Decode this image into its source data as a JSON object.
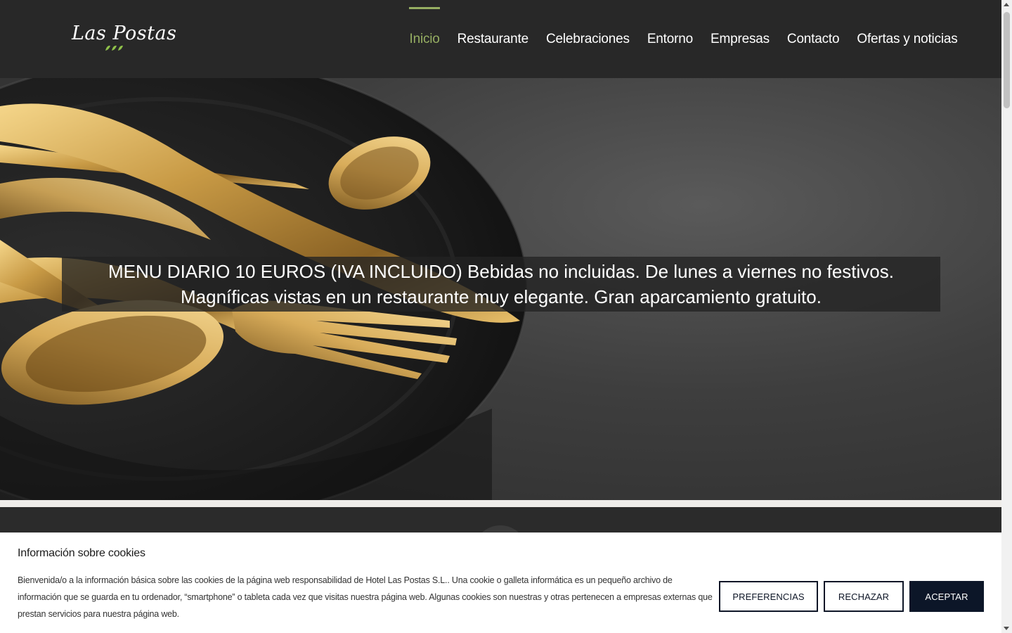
{
  "header": {
    "logo_text": "Las Postas",
    "nav": [
      {
        "label": "Inicio",
        "active": true
      },
      {
        "label": "Restaurante",
        "active": false
      },
      {
        "label": "Celebraciones",
        "active": false
      },
      {
        "label": "Entorno",
        "active": false
      },
      {
        "label": "Empresas",
        "active": false
      },
      {
        "label": "Contacto",
        "active": false
      },
      {
        "label": "Ofertas y noticias",
        "active": false
      }
    ],
    "accent_color": "#96ae62"
  },
  "hero": {
    "caption": "MENU DIARIO 10 EUROS (IVA INCLUIDO) Bebidas no incluidas. De lunes a viernes no festivos. Magníficas vistas en un restaurante muy elegante. Gran aparcamiento gratuito.",
    "image_subject": "gold cutlery on black plate"
  },
  "cookie_banner": {
    "title": "Información sobre cookies",
    "text": "Bienvenida/o a la información básica sobre las cookies de la página web responsabilidad de Hotel Las Postas S.L.. Una cookie o galleta informática es un pequeño archivo de información que se guarda en tu ordenador, “smartphone” o tableta cada vez que visitas nuestra página web. Algunas cookies son nuestras y otras pertenecen a empresas externas que prestan servicios para nuestra página web.",
    "buttons": {
      "preferences": "PREFERENCIAS",
      "reject": "RECHAZAR",
      "accept": "ACEPTAR"
    },
    "accept_color": "#0c1628"
  }
}
